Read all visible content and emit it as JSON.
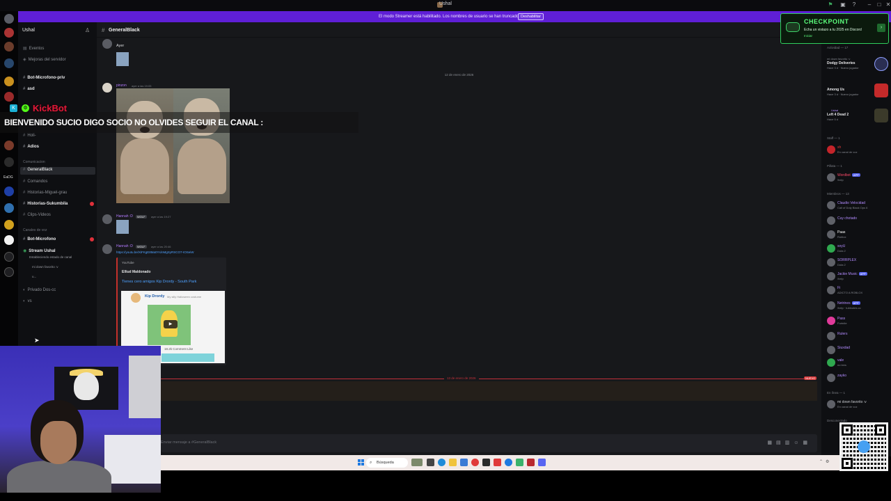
{
  "window": {
    "title": "Ushal"
  },
  "streamer_mode": {
    "message": "El modo Streamer está habilitado. Los nombres de usuario se han truncado.",
    "button": "Deshabilitar"
  },
  "checkpoint": {
    "title": "CHECKPOINT",
    "body": "Echa un vistazo a tu 2025 en Discord",
    "link": "Iniciar"
  },
  "server": {
    "name": "Ushal",
    "top_items": [
      "Eventos",
      "Mejoras del servidor"
    ],
    "channels": [
      {
        "name": "Bot-Microfono-priv",
        "style": "bold"
      },
      {
        "name": "asd",
        "style": "bold"
      },
      {
        "name": "Holi-",
        "style": "normal"
      },
      {
        "name": "Adios",
        "style": "bold"
      }
    ],
    "category_text": "Comunicacion",
    "text_channels": [
      {
        "name": "GeneralBlack",
        "style": "active"
      },
      {
        "name": "Comandos",
        "style": "normal"
      },
      {
        "name": "Historias-Miguel-grau",
        "style": "normal"
      },
      {
        "name": "Historias-Sukumbila",
        "style": "bold"
      },
      {
        "name": "Clips-Videos",
        "style": "normal"
      }
    ],
    "category_voice": "Canales de voz",
    "voice_channels": [
      {
        "name": "Bot-Microfono",
        "style": "bold"
      },
      {
        "name": "Stream Ushal",
        "style": "bold"
      }
    ],
    "stream_sub": "Estableciendo estado de canal",
    "voice_members": [
      "mi down favorito :v",
      "u..."
    ],
    "more_channels": [
      "Privado Dos-cc",
      "vs"
    ]
  },
  "chat": {
    "channel_name": "GeneralBlack",
    "messages": [
      {
        "text": "Ayer"
      },
      {
        "date_separator": "12 de enero de 2026"
      },
      {
        "author": "pinzon",
        "time": "ayer a las 19:05"
      },
      {
        "author": "Hannah :D",
        "tag": "WOLF",
        "time": "ayer a las 19:27"
      },
      {
        "author": "Hannah :D",
        "tag": "WOLF",
        "time": "ayer a las 20:46",
        "link": "https://youtu.be/XiFKgE8Ma0Ys/nMgSyRSCO7-IOSeiW"
      }
    ],
    "embed": {
      "provider": "YouTube",
      "author": "Elliud Maldonado",
      "title": "Tienes cero amigos Kip Drordy - South Park",
      "channel": "Kip Drordy",
      "desc": "My silly Halloween costume",
      "meta": "18.2k   Comment   Like"
    },
    "new_separator": "13 de enero de 2026",
    "new_badge": "NUEVO",
    "composer_placeholder": "Enviar mensaje a #GeneralBlack"
  },
  "kickbot": {
    "name": "KickBot",
    "message": "BIENVENIDO SUCIO DIGO SOCIO NO OLVIDES SEGUIR EL CANAL :"
  },
  "members": {
    "activity_header": "Actividad — 17",
    "games": [
      {
        "who": "mi down favorito :v",
        "game": "Dodgy Deliveries",
        "sub": "Hace 3 d · Nuevo jugador"
      },
      {
        "who": "",
        "game": "Among Us",
        "sub": "Hace 3 d · Nuevo jugador"
      },
      {
        "who": "Ushal",
        "game": "Left 4 Dead 2",
        "sub": "Hace 5 d"
      }
    ],
    "staff_header": "Staff — 1",
    "staff": [
      {
        "name": "sh",
        "status": "En canal de voz"
      }
    ],
    "pillars_header": "Pillata — 1",
    "pillars": [
      {
        "name": "Wordbot",
        "app": "APP",
        "status": "!help"
      }
    ],
    "members_header": "Miembros — 13",
    "list": [
      {
        "name": "Claudio Velocidad",
        "status": "Call of Duty Black Ops 6"
      },
      {
        "name": "Cuy chotado",
        "status": ""
      },
      {
        "name": "Paas",
        "status": "Roblox"
      },
      {
        "name": "soyU",
        "status": "Dota 2"
      },
      {
        "name": "SORRPLEX",
        "status": "Dota 2"
      },
      {
        "name": "Jackie Music",
        "app": "APP",
        "status": "/help"
      },
      {
        "name": "Fi",
        "status": "ADICTO A ROBLOX"
      },
      {
        "name": "Netrines",
        "app": "APP",
        "status": "/help · tubinotes.cc"
      },
      {
        "name": "Pass",
        "status": "Fortnite"
      },
      {
        "name": "Rulers",
        "status": ""
      },
      {
        "name": "Siuxdad",
        "status": ""
      },
      {
        "name": "vale",
        "status": "no lees"
      },
      {
        "name": "zayko",
        "status": ""
      }
    ],
    "online_header": "En línea — 1",
    "online": [
      {
        "name": "mi down favorito :v",
        "status": "En canal de voz"
      }
    ],
    "offline_header": "Desconectado"
  },
  "taskbar": {
    "search_label": "Búsqueda"
  },
  "colors": {
    "accent": "#5f1fd6",
    "checkpoint": "#2fcf5d",
    "kick_green": "#53fc18",
    "new_red": "#c3303a"
  }
}
